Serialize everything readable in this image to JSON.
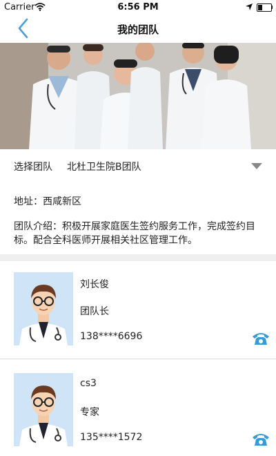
{
  "status_bar": {
    "carrier": "Carrier",
    "time": "6:56 PM"
  },
  "nav": {
    "title": "我的团队"
  },
  "team": {
    "select_label": "选择团队",
    "selected_team": "北杜卫生院B团队",
    "address": "地址：西咸新区",
    "intro": "团队介绍：积极开展家庭医生签约服务工作，完成签约目标。配合全科医师开展相关社区管理工作。"
  },
  "members": [
    {
      "name": "刘长俊",
      "role": "团队长",
      "phone": "138****6696"
    },
    {
      "name": "cs3",
      "role": "专家",
      "phone": "135****1572"
    }
  ],
  "colors": {
    "accent": "#4a9fd8",
    "phone_icon": "#3a9ad6",
    "divider": "#dcdcdc",
    "section_gap": "#efefef"
  }
}
